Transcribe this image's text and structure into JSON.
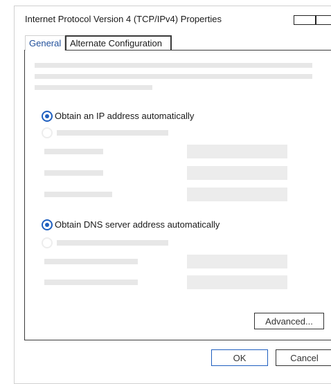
{
  "window": {
    "title": "Internet Protocol Version 4 (TCP/IPv4) Properties"
  },
  "tabs": [
    {
      "label": "General",
      "selected": true
    },
    {
      "label": "Alternate Configuration",
      "selected": false
    }
  ],
  "ip_section": {
    "auto_label": "Obtain an IP address automatically",
    "auto_selected": true
  },
  "dns_section": {
    "auto_label": "Obtain DNS server address automatically",
    "auto_selected": true
  },
  "buttons": {
    "advanced": "Advanced...",
    "ok": "OK",
    "cancel": "Cancel"
  },
  "colors": {
    "accent": "#1f5fbf",
    "tab_text_selected": "#1f4e9a",
    "placeholder": "#e7e7e7"
  }
}
